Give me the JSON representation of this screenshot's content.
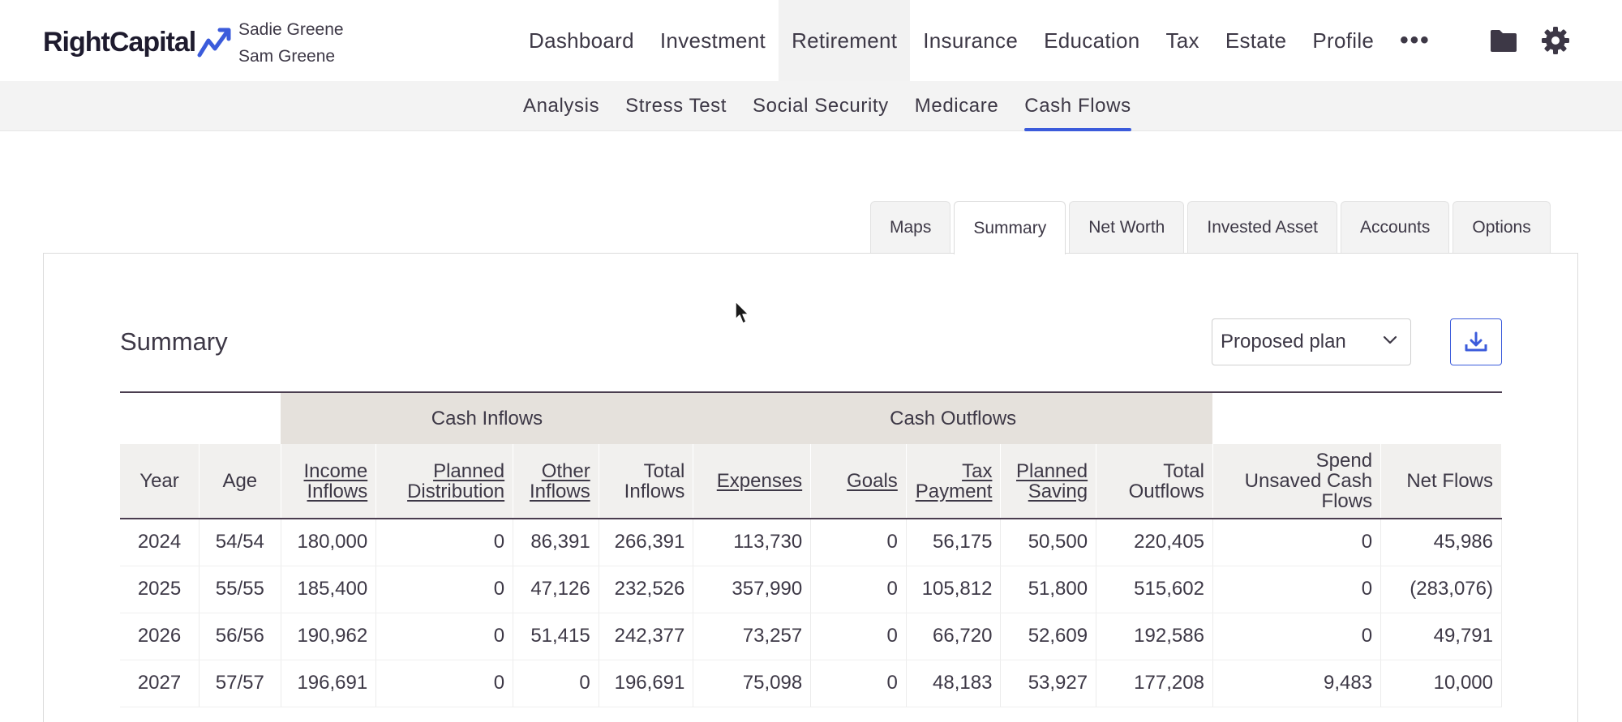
{
  "brand": {
    "logo_text": "RightCapital"
  },
  "clients": [
    "Sadie Greene",
    "Sam Greene"
  ],
  "main_nav": [
    {
      "label": "Dashboard",
      "active": false
    },
    {
      "label": "Investment",
      "active": false
    },
    {
      "label": "Retirement",
      "active": true
    },
    {
      "label": "Insurance",
      "active": false
    },
    {
      "label": "Education",
      "active": false
    },
    {
      "label": "Tax",
      "active": false
    },
    {
      "label": "Estate",
      "active": false
    },
    {
      "label": "Profile",
      "active": false
    }
  ],
  "more_label": "•••",
  "icons": {
    "folder": "folder-icon",
    "settings": "gear-icon",
    "download": "download-icon",
    "chevron": "chevron-down-icon"
  },
  "sub_nav": [
    {
      "label": "Analysis",
      "active": false
    },
    {
      "label": "Stress Test",
      "active": false
    },
    {
      "label": "Social Security",
      "active": false
    },
    {
      "label": "Medicare",
      "active": false
    },
    {
      "label": "Cash Flows",
      "active": true
    }
  ],
  "tabs": [
    {
      "label": "Maps",
      "active": false
    },
    {
      "label": "Summary",
      "active": true
    },
    {
      "label": "Net Worth",
      "active": false
    },
    {
      "label": "Invested Asset",
      "active": false
    },
    {
      "label": "Accounts",
      "active": false
    },
    {
      "label": "Options",
      "active": false
    }
  ],
  "summary": {
    "title": "Summary",
    "plan_select": "Proposed plan"
  },
  "table": {
    "groups": {
      "inflows": "Cash Inflows",
      "outflows": "Cash Outflows"
    },
    "columns": [
      {
        "key": "year",
        "label": [
          "Year"
        ],
        "link": false
      },
      {
        "key": "age",
        "label": [
          "Age"
        ],
        "link": false
      },
      {
        "key": "income",
        "label": [
          "Income",
          "Inflows"
        ],
        "link": true
      },
      {
        "key": "planned_dist",
        "label": [
          "Planned",
          "Distribution"
        ],
        "link": true
      },
      {
        "key": "other",
        "label": [
          "Other",
          "Inflows"
        ],
        "link": true
      },
      {
        "key": "total_in",
        "label": [
          "Total",
          "Inflows"
        ],
        "link": false
      },
      {
        "key": "expenses",
        "label": [
          "Expenses"
        ],
        "link": true
      },
      {
        "key": "goals",
        "label": [
          "Goals"
        ],
        "link": true
      },
      {
        "key": "tax",
        "label": [
          "Tax",
          "Payment"
        ],
        "link": true
      },
      {
        "key": "saving",
        "label": [
          "Planned",
          "Saving"
        ],
        "link": true
      },
      {
        "key": "total_out",
        "label": [
          "Total",
          "Outflows"
        ],
        "link": false
      },
      {
        "key": "spend",
        "label": [
          "Spend",
          "Unsaved Cash",
          "Flows"
        ],
        "link": false
      },
      {
        "key": "net",
        "label": [
          "Net Flows"
        ],
        "link": false
      }
    ],
    "rows": [
      [
        "2024",
        "54/54",
        "180,000",
        "0",
        "86,391",
        "266,391",
        "113,730",
        "0",
        "56,175",
        "50,500",
        "220,405",
        "0",
        "45,986"
      ],
      [
        "2025",
        "55/55",
        "185,400",
        "0",
        "47,126",
        "232,526",
        "357,990",
        "0",
        "105,812",
        "51,800",
        "515,602",
        "0",
        "(283,076)"
      ],
      [
        "2026",
        "56/56",
        "190,962",
        "0",
        "51,415",
        "242,377",
        "73,257",
        "0",
        "66,720",
        "52,609",
        "192,586",
        "0",
        "49,791"
      ],
      [
        "2027",
        "57/57",
        "196,691",
        "0",
        "0",
        "196,691",
        "75,098",
        "0",
        "48,183",
        "53,927",
        "177,208",
        "9,483",
        "10,000"
      ]
    ]
  },
  "colors": {
    "accent": "#3b5bdb",
    "group_header": "#e5e1dc",
    "column_header": "#f1f0ee",
    "rule": "#4a3d4f"
  }
}
